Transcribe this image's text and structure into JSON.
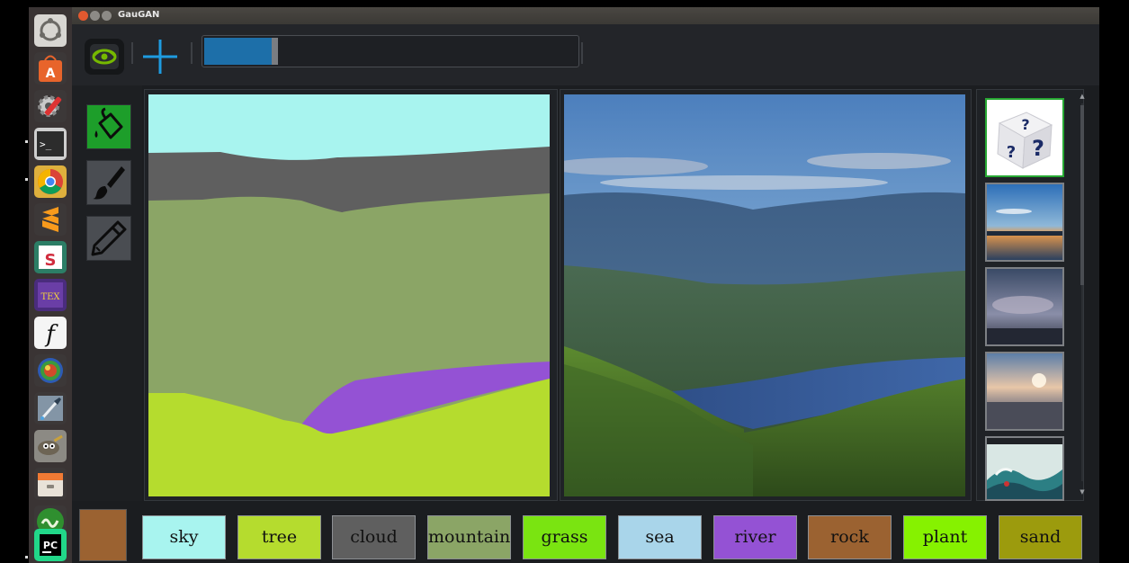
{
  "window": {
    "title": "GauGAN",
    "toolbar": {
      "progress_percent": 18
    }
  },
  "launcher": {
    "items": [
      {
        "name": "ubuntu-dash-icon"
      },
      {
        "name": "software-center-icon"
      },
      {
        "name": "system-settings-icon"
      },
      {
        "name": "terminal-icon"
      },
      {
        "name": "chrome-icon"
      },
      {
        "name": "sublime-text-icon"
      },
      {
        "name": "slack-icon"
      },
      {
        "name": "texmaker-icon",
        "text": "TEX"
      },
      {
        "name": "font-manager-icon",
        "text": "f"
      },
      {
        "name": "color-app-icon"
      },
      {
        "name": "eyedropper-icon"
      },
      {
        "name": "gimp-icon"
      },
      {
        "name": "archive-manager-icon"
      },
      {
        "name": "wacom-icon"
      },
      {
        "name": "pycharm-icon",
        "text": "PC"
      }
    ]
  },
  "tools": [
    {
      "name": "paint-bucket-tool",
      "active": true
    },
    {
      "name": "brush-tool",
      "active": false
    },
    {
      "name": "pencil-tool",
      "active": false
    }
  ],
  "current_color": "#9b6231",
  "labels": [
    {
      "text": "sky",
      "color": "#a8f4ef"
    },
    {
      "text": "tree",
      "color": "#b5dc2e"
    },
    {
      "text": "cloud",
      "color": "#5f5f5f"
    },
    {
      "text": "mountain",
      "color": "#8ba566"
    },
    {
      "text": "grass",
      "color": "#7ae411"
    },
    {
      "text": "sea",
      "color": "#a9d5ea"
    },
    {
      "text": "river",
      "color": "#9452d4"
    },
    {
      "text": "rock",
      "color": "#9b6231"
    },
    {
      "text": "plant",
      "color": "#86f200"
    },
    {
      "text": "sand",
      "color": "#9c9b0d"
    }
  ],
  "style_thumbnails": [
    {
      "name": "random-style-dice",
      "selected": true
    },
    {
      "name": "sunset-lake-style",
      "selected": false
    },
    {
      "name": "cloudy-dusk-style",
      "selected": false
    },
    {
      "name": "city-sunset-style",
      "selected": false
    },
    {
      "name": "wave-painting-style",
      "selected": false
    }
  ]
}
